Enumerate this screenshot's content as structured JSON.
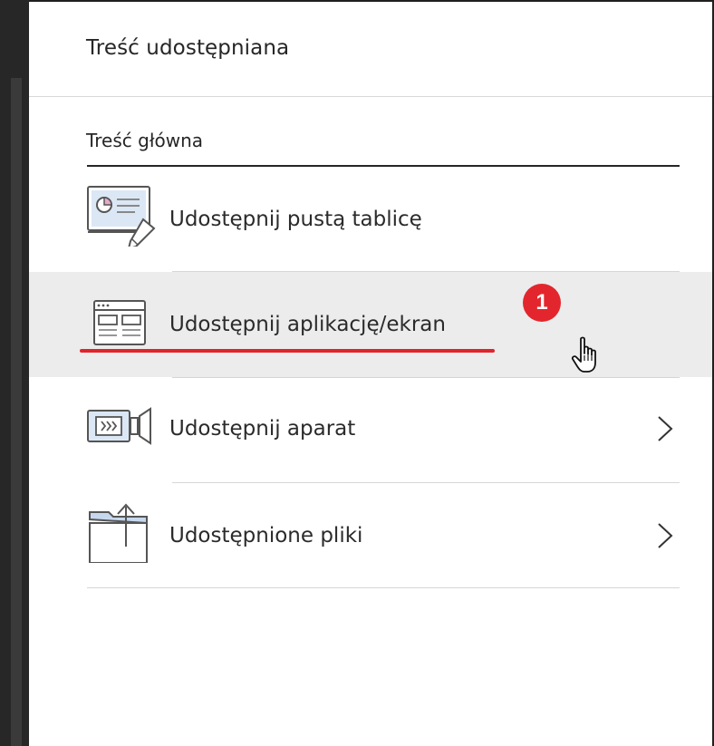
{
  "panel": {
    "title": "Treść udostępniana",
    "section_heading": "Treść główna"
  },
  "menu": {
    "items": [
      {
        "label": "Udostępnij pustą tablicę",
        "icon": "whiteboard-icon",
        "has_submenu": false
      },
      {
        "label": "Udostępnij aplikację/ekran",
        "icon": "application-window-icon",
        "has_submenu": false,
        "hovered": true
      },
      {
        "label": "Udostępnij aparat",
        "icon": "camera-icon",
        "has_submenu": true
      },
      {
        "label": "Udostępnione pliki",
        "icon": "folder-upload-icon",
        "has_submenu": true
      }
    ]
  },
  "annotation": {
    "step_number": "1",
    "step_color": "#e3262d",
    "underline_color": "#e2242a"
  },
  "colors": {
    "hover_background": "#ececec",
    "text": "#262626",
    "sidebar": "#272727"
  }
}
